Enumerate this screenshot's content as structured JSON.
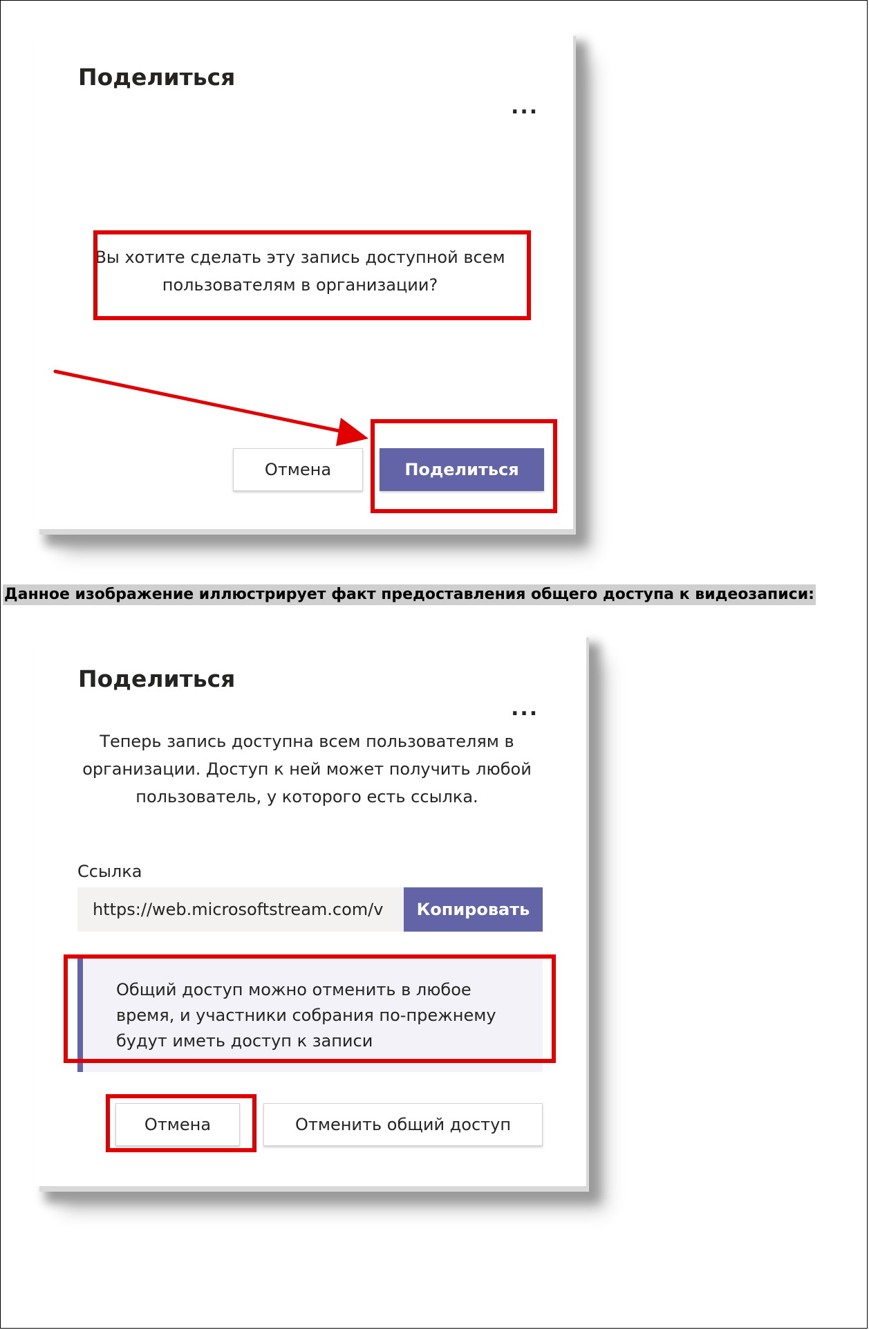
{
  "dialog1": {
    "title": "Поделиться",
    "more_label": "...",
    "message_line1": "Вы хотите сделать эту запись доступной всем",
    "message_line2": "пользователям в организации?",
    "cancel_label": "Отмена",
    "share_label": "Поделиться"
  },
  "caption": "Данное изображение иллюстрирует факт предоставления общего доступа к видеозаписи:",
  "dialog2": {
    "title": "Поделиться",
    "more_label": "...",
    "message_line1": "Теперь запись доступна всем пользователям в",
    "message_line2": "организации. Доступ к ней может получить любой",
    "message_line3": "пользователь, у которого есть ссылка.",
    "link_label": "Ссылка",
    "link_value": "https://web.microsoftstream.com/v",
    "copy_label": "Копировать",
    "info_line1": "Общий доступ можно отменить в любое",
    "info_line2": "время, и участники собрания по-прежнему",
    "info_line3": "будут иметь доступ к записи",
    "cancel_label": "Отмена",
    "unshare_label": "Отменить общий доступ"
  },
  "colors": {
    "accent": "#6264a7",
    "highlight": "#e00000",
    "info_background": "#f3f2f9"
  }
}
